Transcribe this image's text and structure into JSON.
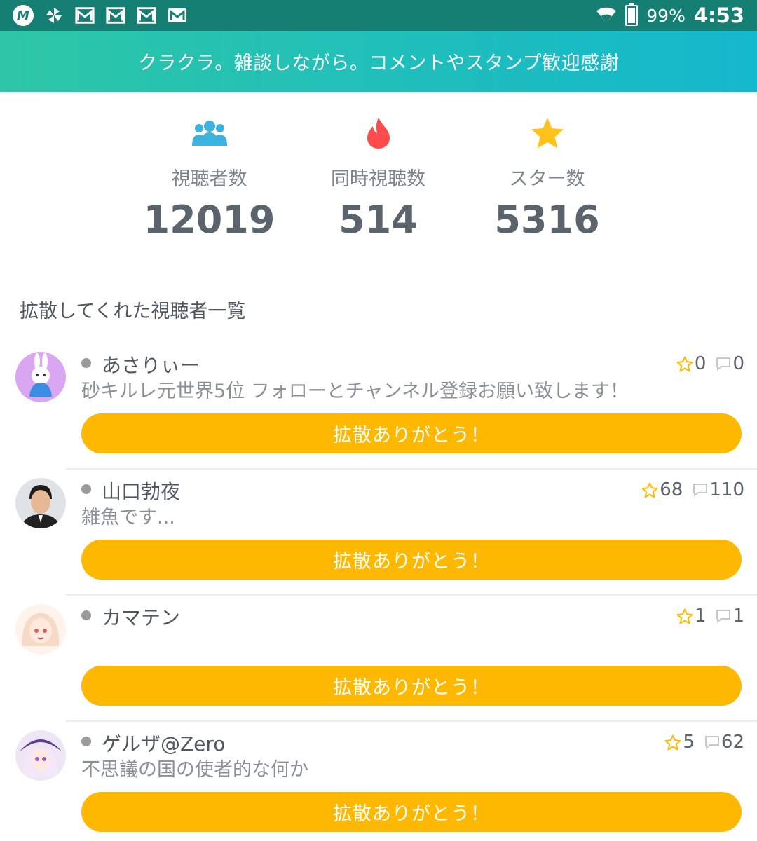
{
  "status_bar": {
    "battery": "99%",
    "time": "4:53",
    "app_icon_letter": "M"
  },
  "header": {
    "title": "クラクラ。雑談しながら。コメントやスタンプ歓迎感謝"
  },
  "stats": [
    {
      "icon": "people-icon",
      "label": "視聴者数",
      "value": "12019"
    },
    {
      "icon": "flame-icon",
      "label": "同時視聴数",
      "value": "514"
    },
    {
      "icon": "star-icon",
      "label": "スター数",
      "value": "5316"
    }
  ],
  "section_title": "拡散してくれた視聴者一覧",
  "viewers": [
    {
      "name": "あさりぃー",
      "comment": "砂キルレ元世界5位  フォローとチャンネル登録お願い致します！",
      "stars": "0",
      "comments": "0",
      "button": "拡散ありがとう！"
    },
    {
      "name": "山口勃夜",
      "comment": "雑魚です...",
      "stars": "68",
      "comments": "110",
      "button": "拡散ありがとう！"
    },
    {
      "name": "カマテン",
      "comment": "",
      "stars": "1",
      "comments": "1",
      "button": "拡散ありがとう！"
    },
    {
      "name": "ゲルザ@Zero",
      "comment": "不思議の国の使者的な何か",
      "stars": "5",
      "comments": "62",
      "button": "拡散ありがとう！"
    }
  ],
  "colors": {
    "status_bar": "#167f74",
    "header_gradient_start": "#2dc6a6",
    "header_gradient_end": "#14b8cd",
    "people_icon": "#3bb3e0",
    "flame_icon": "#ff4b4b",
    "star_icon": "#ffc21a",
    "button": "#ffb800"
  }
}
